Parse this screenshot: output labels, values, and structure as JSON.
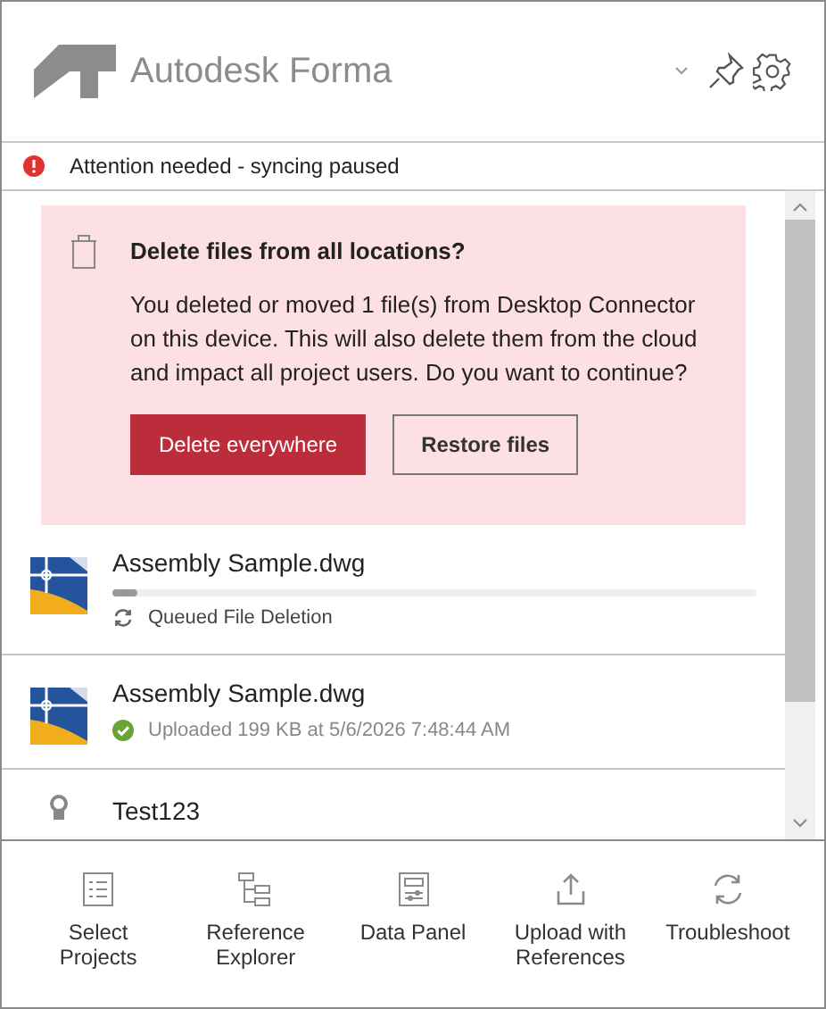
{
  "header": {
    "title": "Autodesk Forma"
  },
  "status": {
    "text": "Attention needed - syncing paused"
  },
  "alert": {
    "title": "Delete files from all locations?",
    "message": "You deleted or moved 1 file(s) from Desktop Connector on this device. This will also delete them from the cloud and impact all project users. Do you want to continue?",
    "buttons": [
      {
        "label": "Delete everywhere",
        "kind": "primary"
      },
      {
        "label": "Restore files",
        "kind": "secondary"
      }
    ]
  },
  "items": [
    {
      "kind": "file",
      "name": "Assembly Sample.dwg",
      "uploaded": false,
      "level": 0.04,
      "status": "Queued File Deletion"
    },
    {
      "kind": "file",
      "name": "Assembly Sample.dwg",
      "uploaded": true,
      "status": "Uploaded 199 KB at 5/6/2026 7:48:44 AM"
    },
    {
      "kind": "project",
      "name": "Test123"
    }
  ],
  "footer": [
    {
      "label": "Select Projects"
    },
    {
      "label": "Reference Explorer"
    },
    {
      "label": "Data Panel"
    },
    {
      "label": "Upload with References"
    },
    {
      "label": "Troubleshoot"
    }
  ]
}
